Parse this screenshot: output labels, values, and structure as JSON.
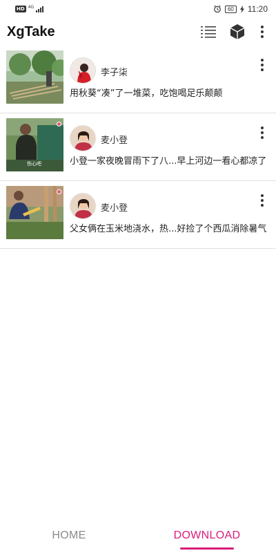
{
  "status_bar": {
    "network_badge": "HD",
    "network_type": "4G",
    "battery": "60",
    "time": "11:20"
  },
  "app_bar": {
    "title": "XgTake",
    "icons": [
      "list-view-icon",
      "package-box-icon",
      "overflow-menu-icon"
    ]
  },
  "videos": [
    {
      "author": "李子柒",
      "title": "用秋葵“凑”了一堆菜，吃饱喝足乐颠颠"
    },
    {
      "author": "麦小登",
      "title": "小登一家夜晚冒雨下了八...早上河边一看心都凉了",
      "thumb_caption": "伤心吧"
    },
    {
      "author": "麦小登",
      "title": "父女俩在玉米地浇水，热...好捡了个西瓜消除暑气"
    }
  ],
  "bottom_nav": {
    "tabs": [
      {
        "label": "HOME",
        "active": false
      },
      {
        "label": "DOWNLOAD",
        "active": true
      }
    ]
  },
  "colors": {
    "accent": "#d81b7a",
    "inactive_tab": "#8a8a8a",
    "divider": "#e0e0e0"
  }
}
